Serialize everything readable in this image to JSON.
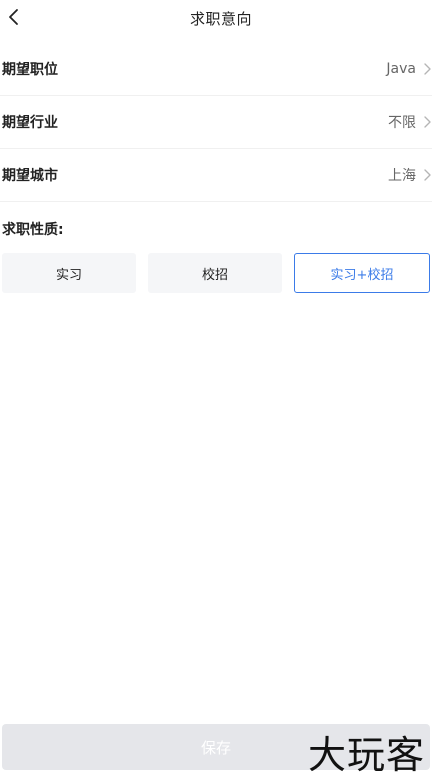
{
  "header": {
    "title": "求职意向"
  },
  "preferences": [
    {
      "label": "期望职位",
      "value": "Java"
    },
    {
      "label": "期望行业",
      "value": "不限"
    },
    {
      "label": "期望城市",
      "value": "上海"
    }
  ],
  "job_nature": {
    "label": "求职性质:",
    "options": [
      {
        "label": "实习"
      },
      {
        "label": "校招"
      },
      {
        "label": "实习+校招"
      }
    ],
    "selected": "实习+校招"
  },
  "save_label": "保存",
  "watermark": "大玩客",
  "colors": {
    "accent": "#3b7be8",
    "option_bg": "#f5f6f8",
    "save_disabled_bg": "#e5e6ea"
  }
}
